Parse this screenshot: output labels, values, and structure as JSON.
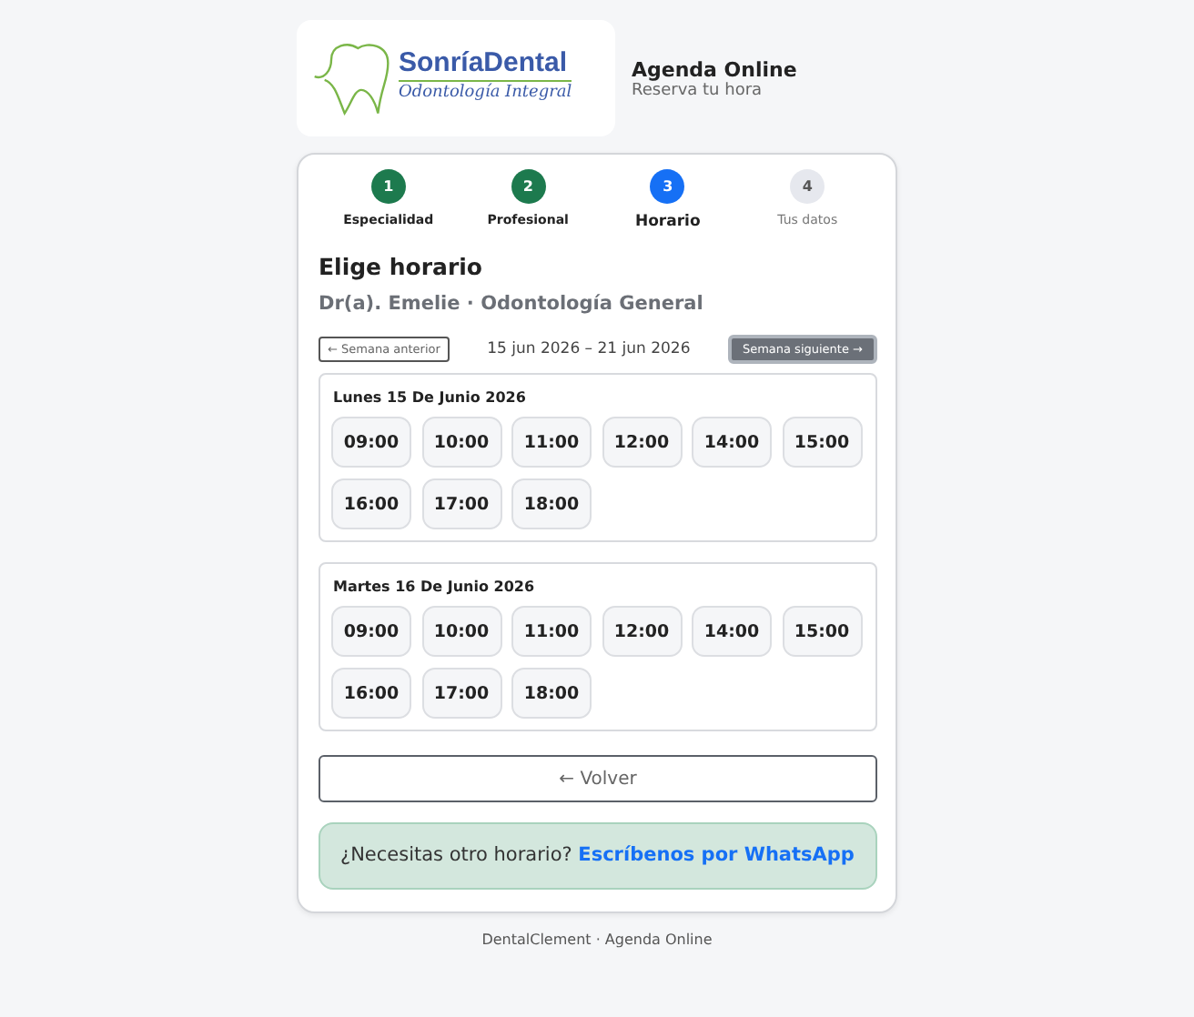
{
  "header": {
    "logo_name": "SonríaDental",
    "logo_tagline": "Odontología Integral",
    "title": "Agenda Online",
    "subtitle": "Reserva tu hora"
  },
  "steps": [
    {
      "number": "1",
      "label": "Especialidad",
      "completed": true,
      "selected": false
    },
    {
      "number": "2",
      "label": "Profesional",
      "completed": true,
      "selected": false
    },
    {
      "number": "3",
      "label": "Horario",
      "completed": false,
      "selected": true
    },
    {
      "number": "4",
      "label": "Tus datos",
      "completed": false,
      "selected": false
    }
  ],
  "heading": "Elige horario",
  "professional": "Dr(a). Emelie · Odontología General",
  "week_nav": {
    "previous": "← Semana anterior",
    "range": "15 jun 2026 – 21 jun 2026",
    "next": "Semana siguiente →"
  },
  "days": [
    {
      "title": "Lunes 15 De Junio 2026",
      "slots": [
        "09:00",
        "10:00",
        "11:00",
        "12:00",
        "14:00",
        "15:00",
        "16:00",
        "17:00",
        "18:00"
      ]
    },
    {
      "title": "Martes 16 De Junio 2026",
      "slots": [
        "09:00",
        "10:00",
        "11:00",
        "12:00",
        "14:00",
        "15:00",
        "16:00",
        "17:00",
        "18:00"
      ]
    }
  ],
  "back_button": "← Volver",
  "whatsapp_notice": {
    "text": "¿Necesitas otro horario?",
    "link": "Escríbenos por WhatsApp"
  },
  "footer": "DentalClement · Agenda Online"
}
